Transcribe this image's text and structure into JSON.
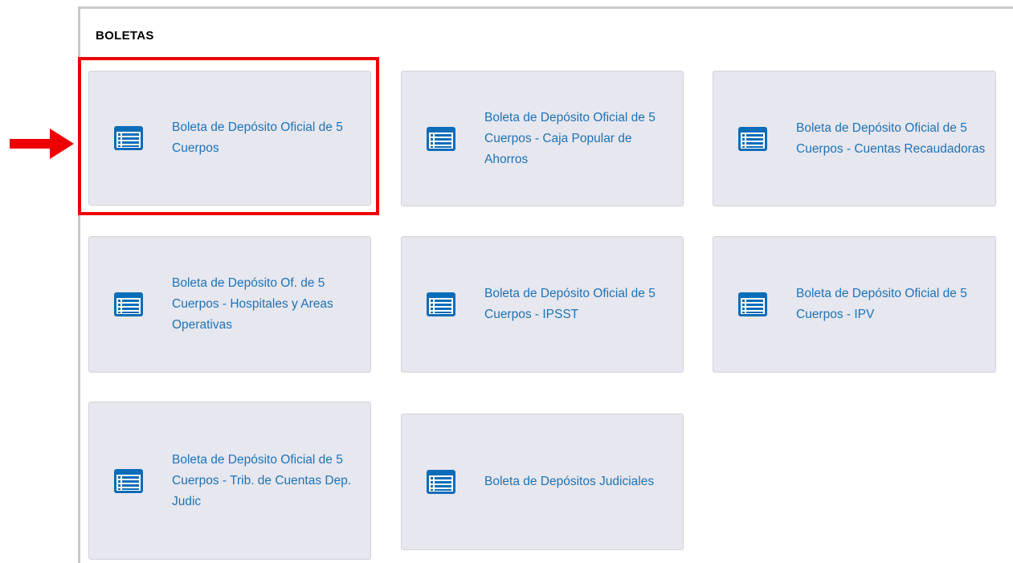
{
  "section": {
    "title": "BOLETAS"
  },
  "icon": {
    "name": "list-form-icon",
    "color": "#0b6cb8"
  },
  "cards": [
    {
      "label": "Boleta de Depósito Oficial de 5 Cuerpos"
    },
    {
      "label": "Boleta de Depósito Oficial de 5 Cuerpos - Caja Popular de Ahorros"
    },
    {
      "label": "Boleta de Depósito Oficial de 5 Cuerpos - Cuentas Recaudadoras"
    },
    {
      "label": "Boleta de Depósito Of. de 5 Cuerpos - Hospitales y Areas Operativas"
    },
    {
      "label": "Boleta de Depósito Oficial de 5 Cuerpos - IPSST"
    },
    {
      "label": "Boleta de Depósito Oficial de 5 Cuerpos - IPV"
    },
    {
      "label": "Boleta de Depósito Oficial de 5 Cuerpos - Trib. de Cuentas Dep. Judic"
    },
    {
      "label": "Boleta de Depósitos Judiciales"
    }
  ],
  "annotation": {
    "highlight_color": "#ee0000",
    "arrow_color": "#ee0000"
  }
}
